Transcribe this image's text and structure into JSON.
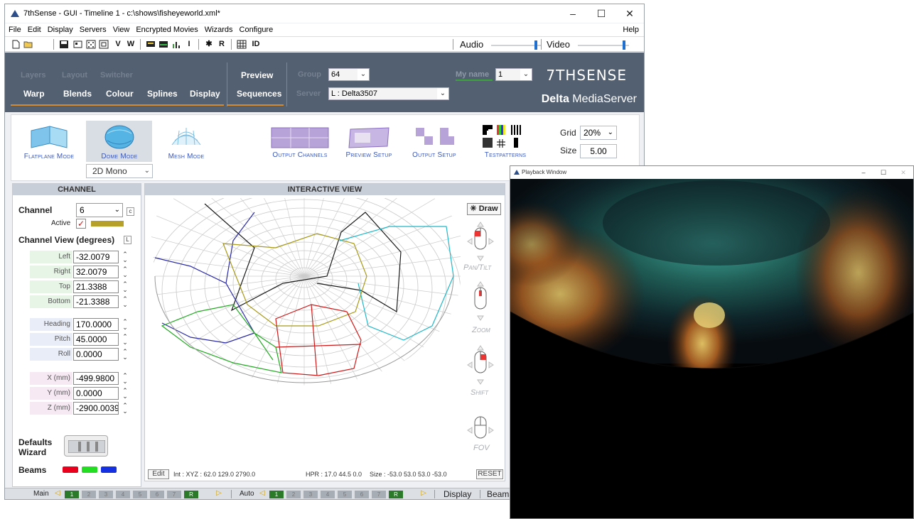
{
  "window": {
    "title": "7thSense -  GUI  - Timeline 1  - c:\\shows\\fisheyeworld.xml*",
    "controls": [
      "–",
      "☐",
      "✕"
    ]
  },
  "menu": [
    "File",
    "Edit",
    "Display",
    "Servers",
    "View",
    "Encrypted Movies",
    "Wizards",
    "Configure"
  ],
  "menu_help": "Help",
  "toolbar": {
    "letters": [
      "V",
      "W",
      "I",
      "R",
      "ID"
    ],
    "audio_label": "Audio",
    "video_label": "Video",
    "audio_level": 0.9,
    "video_level": 0.9
  },
  "header": {
    "dim_tabs": [
      "Layers",
      "Layout",
      "Switcher"
    ],
    "tabs": [
      "Warp",
      "Blends",
      "Colour",
      "Splines",
      "Display"
    ],
    "active_tab": "Display",
    "preview": "Preview",
    "sequences": "Sequences",
    "group_label": "Group",
    "group_value": "64",
    "server_label": "Server",
    "server_value": "L : Delta3507",
    "myname_label": "My name",
    "myname_value": "1",
    "brand": "7THSENSE",
    "brand_sub_bold": "Delta",
    "brand_sub": " MediaServer"
  },
  "modes": {
    "flatplane": "Flatplane Mode",
    "dome": "Dome Mode",
    "mesh": "Mesh Mode",
    "dome_dropdown": "2D Mono",
    "output_channels": "Output Channels",
    "preview_setup": "Preview Setup",
    "output_setup": "Output Setup",
    "testpatterns": "Testpatterns",
    "grid_label": "Grid",
    "grid_value": "20%",
    "size_label": "Size",
    "size_value": "5.00"
  },
  "channel": {
    "header": "CHANNEL",
    "channel_label": "Channel",
    "channel_value": "6",
    "active_label": "Active",
    "active_color": "#b7a02a",
    "view_label": "Channel View (degrees)",
    "fields": [
      {
        "label": "Left",
        "value": "-32.0079"
      },
      {
        "label": "Right",
        "value": "32.0079"
      },
      {
        "label": "Top",
        "value": "21.3388"
      },
      {
        "label": "Bottom",
        "value": "-21.3388"
      },
      {
        "label": "Heading",
        "value": "170.0000"
      },
      {
        "label": "Pitch",
        "value": "45.0000"
      },
      {
        "label": "Roll",
        "value": "0.0000"
      },
      {
        "label": "X (mm)",
        "value": "-499.9800"
      },
      {
        "label": "Y (mm)",
        "value": "0.0000"
      },
      {
        "label": "Z (mm)",
        "value": "-2900.0039"
      }
    ],
    "defaults_wizard": "Defaults\nWizard",
    "beams_label": "Beams",
    "beam_colors": [
      "#e8001c",
      "#22dd22",
      "#1530e0"
    ]
  },
  "interactive": {
    "header": "INTERACTIVE VIEW",
    "draw": "Draw",
    "pan_tilt": "Pan/Tilt",
    "zoom": "Zoom",
    "shift": "Shift",
    "fov": "FOV",
    "edit": "Edit",
    "int_xyz": "Int : XYZ  :  62.0   129.0   2790.0",
    "hpr": "HPR :  17.0   44.5   0.0",
    "size": "Size  :  -53.0   53.0   53.0   -53.0",
    "reset": "RESET"
  },
  "statusbar": {
    "main": "Main",
    "auto": "Auto",
    "cells": [
      "1",
      "2",
      "3",
      "4",
      "5",
      "6",
      "7",
      "R"
    ],
    "display": "Display",
    "beams": "Beams"
  },
  "playback": {
    "title": "Playback Window",
    "controls": [
      "–",
      "☐",
      "✕"
    ]
  }
}
